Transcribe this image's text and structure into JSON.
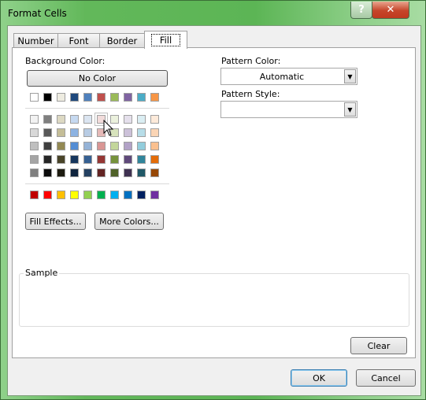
{
  "window": {
    "title": "Format Cells",
    "help_label": "?",
    "close_label": "✕"
  },
  "tabs": [
    {
      "label": "Number"
    },
    {
      "label": "Font"
    },
    {
      "label": "Border"
    },
    {
      "label": "Fill",
      "active": true
    }
  ],
  "fill": {
    "background_color_label": "Background Color:",
    "no_color_label": "No Color",
    "theme_top": [
      "#FFFFFF",
      "#000000",
      "#EEECE1",
      "#1F497D",
      "#4F81BD",
      "#C0504D",
      "#9BBB59",
      "#8064A2",
      "#4BACC6",
      "#F79646"
    ],
    "theme_shades": [
      [
        "#F2F2F2",
        "#7F7F7F",
        "#DDD9C3",
        "#C6D9F0",
        "#DBE5F1",
        "#F2DCDB",
        "#EBF1DD",
        "#E5E0EC",
        "#DBEEF3",
        "#FDEADA"
      ],
      [
        "#D8D8D8",
        "#595959",
        "#C4BD97",
        "#8DB3E2",
        "#B8CCE4",
        "#E5B9B7",
        "#D7E3BC",
        "#CCC1D9",
        "#B7DDE8",
        "#FBD5B5"
      ],
      [
        "#BFBFBF",
        "#3F3F3F",
        "#938953",
        "#548DD4",
        "#95B3D7",
        "#D99694",
        "#C3D69B",
        "#B2A2C7",
        "#92CDDC",
        "#FAC08F"
      ],
      [
        "#A5A5A5",
        "#262626",
        "#494429",
        "#17365D",
        "#366092",
        "#953734",
        "#76923C",
        "#5F497A",
        "#31859B",
        "#E36C09"
      ],
      [
        "#7F7F7F",
        "#0C0C0C",
        "#1D1B10",
        "#0F243E",
        "#244061",
        "#632423",
        "#4F6128",
        "#3F3151",
        "#205867",
        "#974806"
      ]
    ],
    "standard": [
      "#C00000",
      "#FF0000",
      "#FFC000",
      "#FFFF00",
      "#92D050",
      "#00B050",
      "#00B0F0",
      "#0070C0",
      "#002060",
      "#7030A0"
    ],
    "selected": {
      "row": 0,
      "col": 5
    },
    "fill_effects_label": "Fill Effects...",
    "more_colors_label": "More Colors...",
    "pattern_color_label": "Pattern Color:",
    "pattern_color_value": "Automatic",
    "pattern_style_label": "Pattern Style:",
    "pattern_style_value": "",
    "sample_label": "Sample",
    "clear_label": "Clear"
  },
  "footer": {
    "ok_label": "OK",
    "cancel_label": "Cancel"
  }
}
